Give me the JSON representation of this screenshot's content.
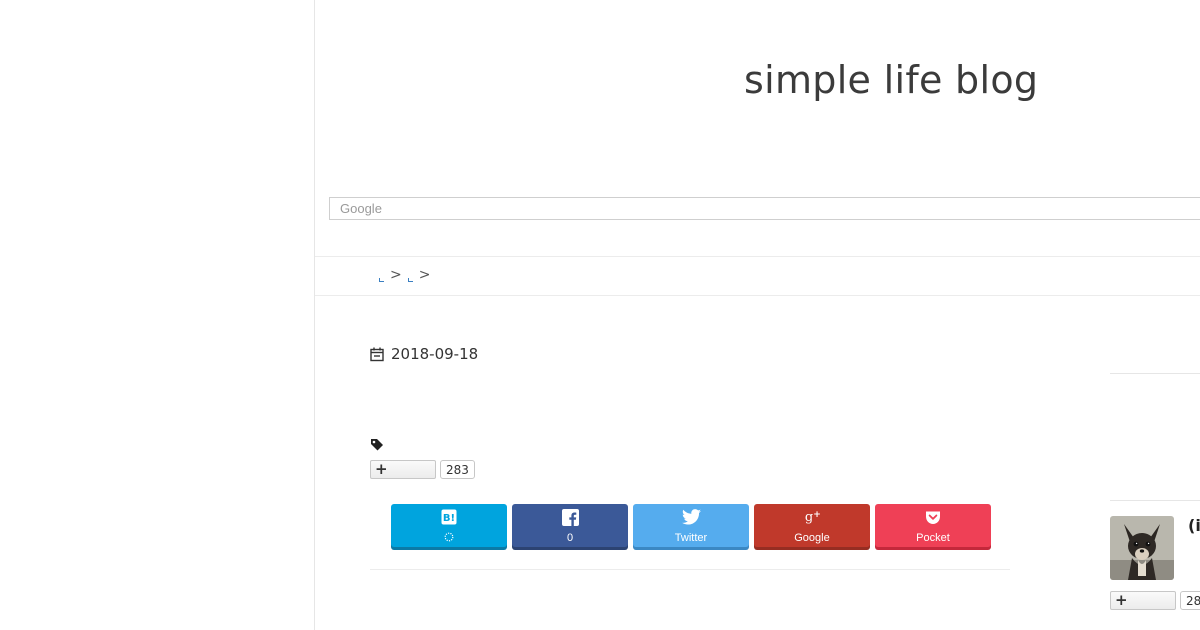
{
  "site": {
    "title": "simple life blog"
  },
  "search": {
    "placeholder": "Google"
  },
  "breadcrumb": {
    "separators": [
      ">",
      ">"
    ]
  },
  "post": {
    "date": "2018-09-18",
    "hatena_bookmark_count": "283"
  },
  "share": {
    "hatena": {
      "label": "",
      "icon": "hatena-bookmark-icon",
      "color": "#00a4de"
    },
    "facebook": {
      "label": "0",
      "icon": "facebook-icon",
      "color": "#3b5998"
    },
    "twitter": {
      "label": "Twitter",
      "icon": "twitter-icon",
      "color": "#55acee"
    },
    "google": {
      "label": "Google",
      "icon": "google-plus-icon",
      "color": "#c0392b"
    },
    "pocket": {
      "label": "Pocket",
      "icon": "pocket-icon",
      "color": "#ef4056"
    }
  },
  "sidebar": {
    "profile_name": "(i",
    "hatena_count": "28"
  },
  "icons": {
    "date": "calendar-icon",
    "tag": "tag-icon",
    "add": "plus-icon"
  }
}
